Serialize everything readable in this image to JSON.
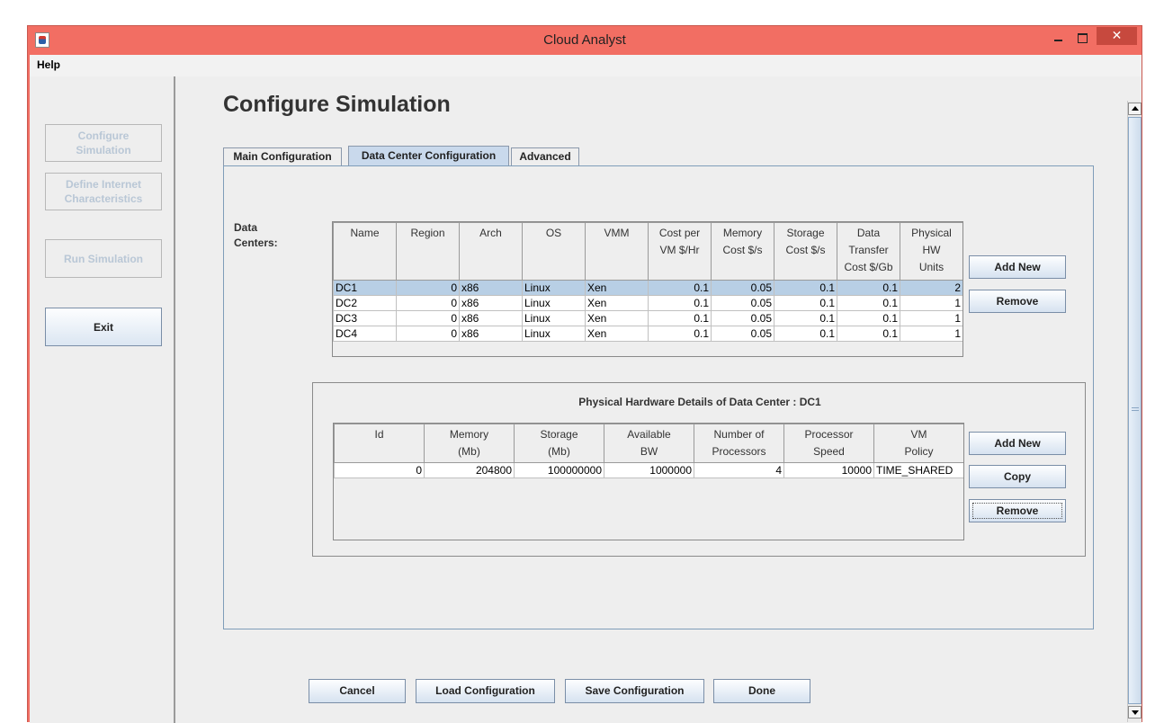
{
  "window": {
    "title": "Cloud Analyst",
    "close_glyph": "✕"
  },
  "menu": {
    "help": "Help"
  },
  "sidebar": {
    "configure": "Configure Simulation",
    "define": "Define Internet Characteristics",
    "run": "Run Simulation",
    "exit": "Exit"
  },
  "page_title": "Configure Simulation",
  "tabs": [
    {
      "label": "Main Configuration"
    },
    {
      "label": "Data Center Configuration"
    },
    {
      "label": "Advanced"
    }
  ],
  "data_centers": {
    "label_line1": "Data",
    "label_line2": "Centers:",
    "headers": [
      [
        "Name"
      ],
      [
        "Region"
      ],
      [
        "Arch"
      ],
      [
        "OS"
      ],
      [
        "VMM"
      ],
      [
        "Cost per",
        "VM $/Hr"
      ],
      [
        "Memory",
        "Cost $/s"
      ],
      [
        "Storage",
        "Cost $/s"
      ],
      [
        "Data",
        "Transfer",
        "Cost $/Gb"
      ],
      [
        "Physical",
        "HW",
        "Units"
      ]
    ],
    "rows": [
      [
        "DC1",
        "0",
        "x86",
        "Linux",
        "Xen",
        "0.1",
        "0.05",
        "0.1",
        "0.1",
        "2"
      ],
      [
        "DC2",
        "0",
        "x86",
        "Linux",
        "Xen",
        "0.1",
        "0.05",
        "0.1",
        "0.1",
        "1"
      ],
      [
        "DC3",
        "0",
        "x86",
        "Linux",
        "Xen",
        "0.1",
        "0.05",
        "0.1",
        "0.1",
        "1"
      ],
      [
        "DC4",
        "0",
        "x86",
        "Linux",
        "Xen",
        "0.1",
        "0.05",
        "0.1",
        "0.1",
        "1"
      ]
    ],
    "selected_row": 0,
    "add_new": "Add New",
    "remove": "Remove"
  },
  "hardware": {
    "title": "Physical Hardware Details of Data Center : DC1",
    "headers": [
      [
        "Id"
      ],
      [
        "Memory",
        "(Mb)"
      ],
      [
        "Storage",
        "(Mb)"
      ],
      [
        "Available",
        "BW"
      ],
      [
        "Number of",
        "Processors"
      ],
      [
        "Processor",
        "Speed"
      ],
      [
        "VM",
        "Policy"
      ]
    ],
    "rows": [
      [
        "0",
        "204800",
        "100000000",
        "1000000",
        "4",
        "10000",
        "TIME_SHARED"
      ]
    ],
    "add_new": "Add New",
    "copy": "Copy",
    "remove": "Remove"
  },
  "footer": {
    "cancel": "Cancel",
    "load": "Load Configuration",
    "save": "Save Configuration",
    "done": "Done"
  }
}
